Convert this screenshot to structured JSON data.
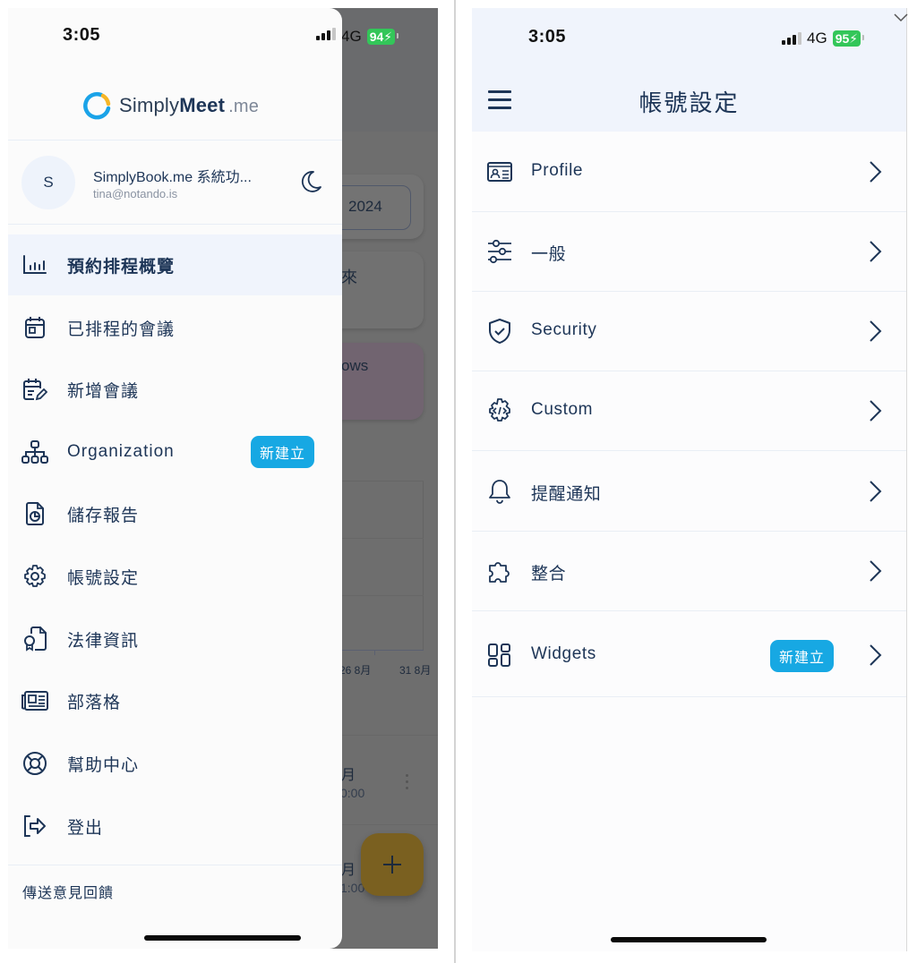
{
  "left_screen": {
    "status_bar": {
      "time": "3:05",
      "network": "4G",
      "battery": "94"
    },
    "drawer": {
      "logo": {
        "name": "Simply",
        "name_bold": "Meet",
        "tld": ".me"
      },
      "user": {
        "avatar_initial": "S",
        "name": "SimplyBook.me 系統功...",
        "email": "tina@notando.is"
      },
      "theme_toggle_icon": "moon-icon",
      "menu": [
        {
          "label": "預約排程概覽",
          "icon": "bar-chart-icon",
          "active": true
        },
        {
          "label": "已排程的會議",
          "icon": "calendar-icon"
        },
        {
          "label": "新增會議",
          "icon": "calendar-edit-icon"
        },
        {
          "label": "Organization",
          "icon": "org-chart-icon",
          "badge": "新建立"
        },
        {
          "label": "儲存報告",
          "icon": "report-file-icon"
        },
        {
          "label": "帳號設定",
          "icon": "gear-icon"
        },
        {
          "label": "法律資訊",
          "icon": "legal-document-icon"
        },
        {
          "label": "部落格",
          "icon": "newspaper-icon"
        },
        {
          "label": "幫助中心",
          "icon": "lifebuoy-icon"
        },
        {
          "label": "登出",
          "icon": "logout-icon"
        }
      ],
      "feedback_link": "傳送意見回饋"
    },
    "background_app": {
      "year": "2024",
      "card_future": "來",
      "card_flows": "ows",
      "chart_x_labels": [
        "26 8月",
        "31 8月"
      ],
      "list": [
        {
          "month": "月",
          "time": "0:00"
        },
        {
          "month": "月",
          "time": "1:00"
        }
      ],
      "fab_icon": "plus-icon"
    }
  },
  "right_screen": {
    "status_bar": {
      "time": "3:05",
      "network": "4G",
      "battery": "95"
    },
    "header": {
      "title": "帳號設定",
      "menu_icon": "hamburger-icon"
    },
    "settings": [
      {
        "label": "Profile",
        "icon": "id-card-icon"
      },
      {
        "label": "一般",
        "icon": "sliders-icon"
      },
      {
        "label": "Security",
        "icon": "shield-check-icon"
      },
      {
        "label": "Custom",
        "icon": "code-gear-icon"
      },
      {
        "label": "提醒通知",
        "icon": "bell-icon"
      },
      {
        "label": "整合",
        "icon": "puzzle-icon"
      },
      {
        "label": "Widgets",
        "icon": "widgets-grid-icon",
        "badge": "新建立"
      }
    ]
  },
  "colors": {
    "primary_text": "#1d3557",
    "badge_bg": "#17a8e3",
    "active_item_bg": "#f0f4fc",
    "header_bg": "#f0f4fc",
    "battery_green": "#33c659",
    "logo_blue": "#1aa3e8",
    "logo_yellow": "#f6b628",
    "fab_dimmed": "#7a6020"
  }
}
